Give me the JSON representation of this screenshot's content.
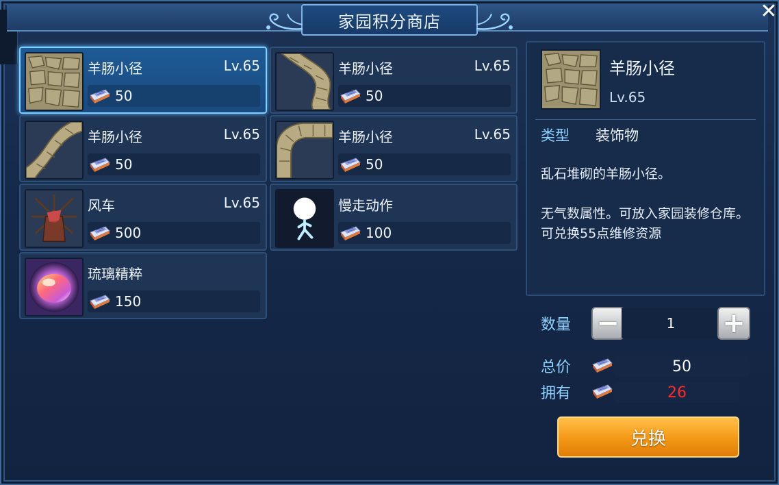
{
  "window": {
    "title": "家园积分商店",
    "close_symbol": "✕"
  },
  "items": [
    {
      "name": "羊肠小径",
      "level": "Lv.65",
      "price": "50",
      "thumb": "stone-path-straight"
    },
    {
      "name": "羊肠小径",
      "level": "Lv.65",
      "price": "50",
      "thumb": "stone-path-curve-down"
    },
    {
      "name": "羊肠小径",
      "level": "Lv.65",
      "price": "50",
      "thumb": "stone-path-curve-up"
    },
    {
      "name": "羊肠小径",
      "level": "Lv.65",
      "price": "50",
      "thumb": "stone-path-arc"
    },
    {
      "name": "风车",
      "level": "Lv.65",
      "price": "500",
      "thumb": "windmill"
    },
    {
      "name": "慢走动作",
      "level": "",
      "price": "100",
      "thumb": "walking-figure"
    },
    {
      "name": "琉璃精粹",
      "level": "",
      "price": "150",
      "thumb": "glass-essence"
    }
  ],
  "selected_index": 0,
  "detail": {
    "name": "羊肠小径",
    "level": "Lv.65",
    "type_label": "类型",
    "type_value": "装饰物",
    "description": [
      "乱石堆砌的羊肠小径。",
      "无气数属性。可放入家园装修仓库。",
      "可兑换55点维修资源"
    ]
  },
  "purchase": {
    "quantity_label": "数量",
    "quantity": "1",
    "minus_symbol": "−",
    "plus_symbol": "+",
    "total_label": "总价",
    "total": "50",
    "owned_label": "拥有",
    "owned": "26",
    "owned_color": "#ff2a2a",
    "exchange_label": "兑换"
  },
  "colors": {
    "accent": "#8fd2ff",
    "button": "#f59b18",
    "selected_border": "#7fd0ff"
  }
}
